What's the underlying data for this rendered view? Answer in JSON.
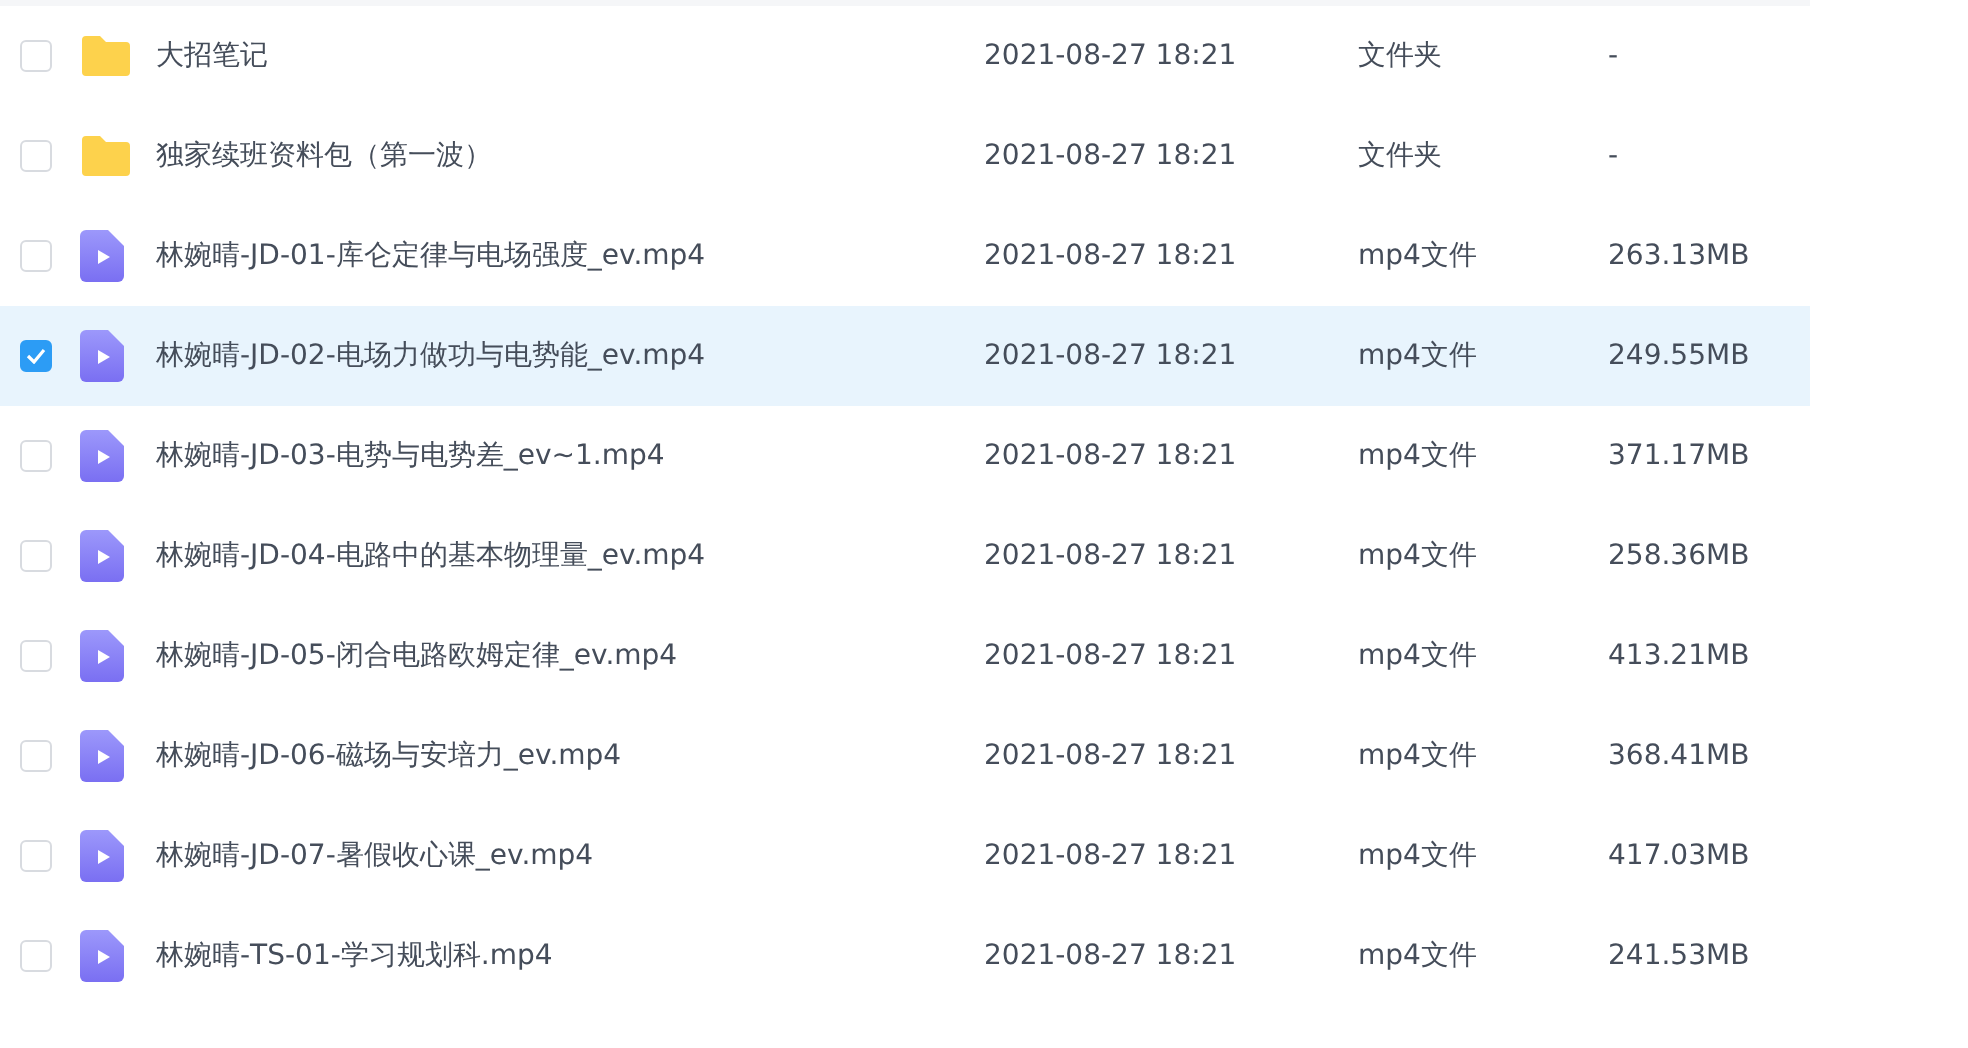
{
  "files": [
    {
      "kind": "folder",
      "selected": false,
      "name": "大招笔记",
      "modified": "2021-08-27 18:21",
      "type": "文件夹",
      "size": "-"
    },
    {
      "kind": "folder",
      "selected": false,
      "name": "独家续班资料包（第一波）",
      "modified": "2021-08-27 18:21",
      "type": "文件夹",
      "size": "-"
    },
    {
      "kind": "video",
      "selected": false,
      "name": "林婉晴-JD-01-库仑定律与电场强度_ev.mp4",
      "modified": "2021-08-27 18:21",
      "type": "mp4文件",
      "size": "263.13MB"
    },
    {
      "kind": "video",
      "selected": true,
      "name": "林婉晴-JD-02-电场力做功与电势能_ev.mp4",
      "modified": "2021-08-27 18:21",
      "type": "mp4文件",
      "size": "249.55MB"
    },
    {
      "kind": "video",
      "selected": false,
      "name": "林婉晴-JD-03-电势与电势差_ev~1.mp4",
      "modified": "2021-08-27 18:21",
      "type": "mp4文件",
      "size": "371.17MB"
    },
    {
      "kind": "video",
      "selected": false,
      "name": "林婉晴-JD-04-电路中的基本物理量_ev.mp4",
      "modified": "2021-08-27 18:21",
      "type": "mp4文件",
      "size": "258.36MB"
    },
    {
      "kind": "video",
      "selected": false,
      "name": "林婉晴-JD-05-闭合电路欧姆定律_ev.mp4",
      "modified": "2021-08-27 18:21",
      "type": "mp4文件",
      "size": "413.21MB"
    },
    {
      "kind": "video",
      "selected": false,
      "name": "林婉晴-JD-06-磁场与安培力_ev.mp4",
      "modified": "2021-08-27 18:21",
      "type": "mp4文件",
      "size": "368.41MB"
    },
    {
      "kind": "video",
      "selected": false,
      "name": "林婉晴-JD-07-暑假收心课_ev.mp4",
      "modified": "2021-08-27 18:21",
      "type": "mp4文件",
      "size": "417.03MB"
    },
    {
      "kind": "video",
      "selected": false,
      "name": "林婉晴-TS-01-学习规划科.mp4",
      "modified": "2021-08-27 18:21",
      "type": "mp4文件",
      "size": "241.53MB"
    }
  ]
}
